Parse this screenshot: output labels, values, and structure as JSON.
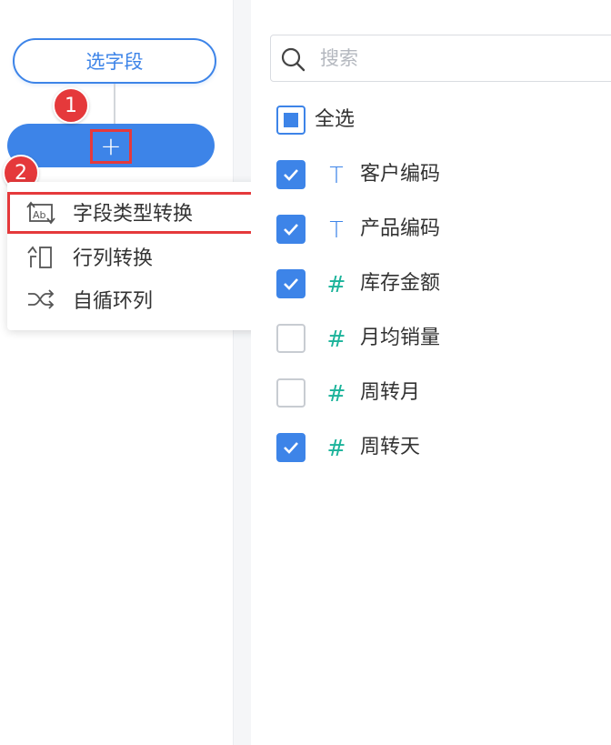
{
  "flow": {
    "select_node_label": "选字段",
    "add_symbol": "+",
    "step_badges": [
      "1",
      "2"
    ]
  },
  "dropdown": {
    "items": [
      {
        "label": "字段类型转换",
        "icon": "type-convert-icon"
      },
      {
        "label": "行列转换",
        "icon": "row-column-transpose-icon"
      },
      {
        "label": "自循环列",
        "icon": "self-loop-shuffle-icon"
      }
    ]
  },
  "field_panel": {
    "search_placeholder": "搜索",
    "select_all": {
      "label": "全选",
      "state": "partial"
    },
    "fields": [
      {
        "label": "客户编码",
        "type": "T",
        "checked": true
      },
      {
        "label": "产品编码",
        "type": "T",
        "checked": true
      },
      {
        "label": "库存金额",
        "type": "#",
        "checked": true
      },
      {
        "label": "月均销量",
        "type": "#",
        "checked": false
      },
      {
        "label": "周转月",
        "type": "#",
        "checked": false
      },
      {
        "label": "周转天",
        "type": "#",
        "checked": true
      }
    ]
  },
  "colors": {
    "accent": "#3d84e8",
    "annotation_red": "#e5393b",
    "number_type": "#1bb39a"
  }
}
